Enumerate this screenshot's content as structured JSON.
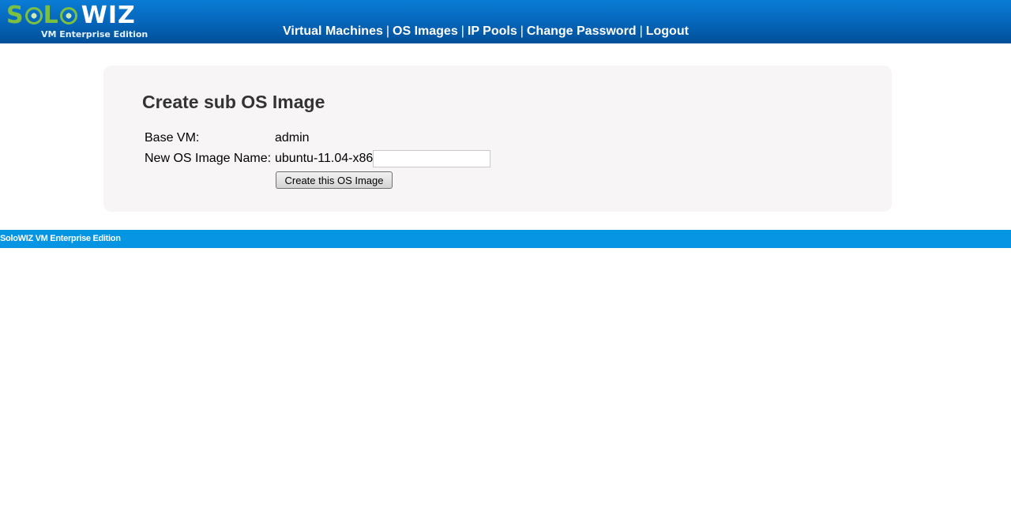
{
  "header": {
    "logo": {
      "word_left": "SOLO",
      "word_right": "WIZ",
      "subtitle": "VM Enterprise Edition",
      "colors": {
        "green": "#7bc043",
        "white": "#ffffff"
      }
    },
    "nav": {
      "items": [
        {
          "label": "Virtual Machines"
        },
        {
          "label": "OS Images"
        },
        {
          "label": "IP Pools"
        },
        {
          "label": "Change Password"
        },
        {
          "label": "Logout"
        }
      ],
      "separator": "|"
    },
    "background_color": "#0564b8"
  },
  "form": {
    "title": "Create sub OS Image",
    "base_vm": {
      "label": "Base VM:",
      "value": "admin"
    },
    "new_name": {
      "label": "New OS Image Name:",
      "prefix": "ubuntu-11.04-x86-",
      "value": ""
    },
    "submit_label": "Create this OS Image"
  },
  "footer": {
    "text": "SoloWIZ VM Enterprise Edition",
    "background_color": "#0695e2"
  }
}
